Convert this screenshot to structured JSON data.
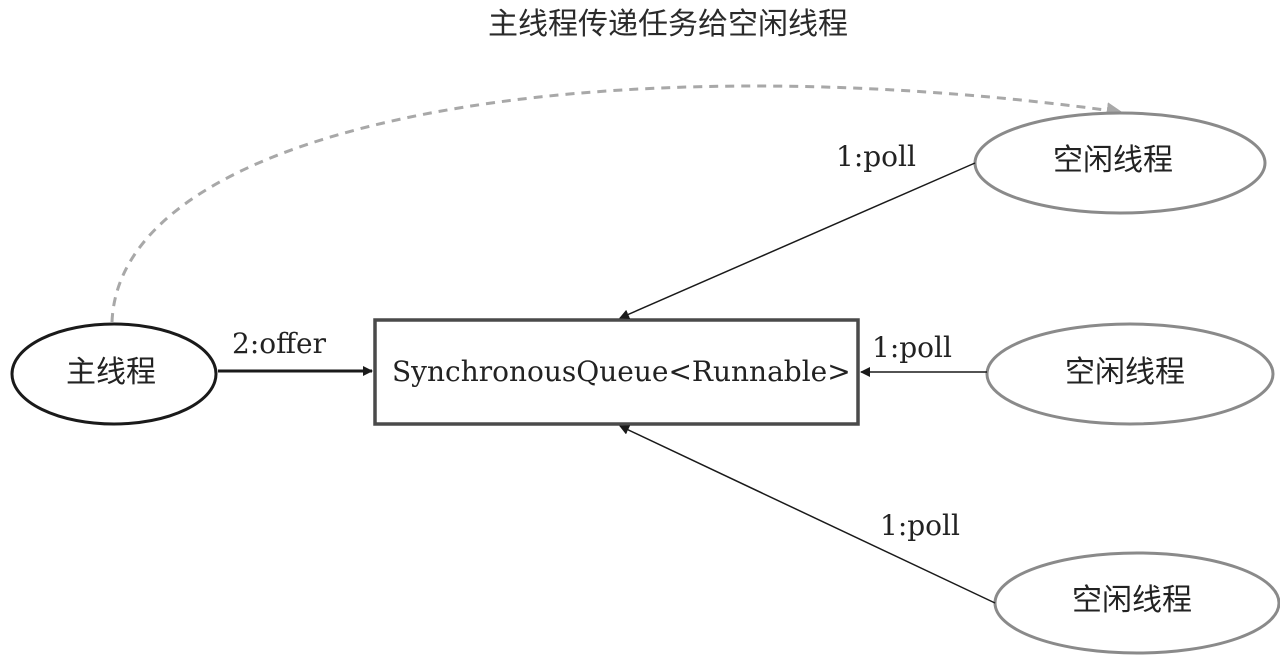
{
  "title": "主线程传递任务给空闲线程",
  "nodes": {
    "main_thread": "主线程",
    "queue": "SynchronousQueue<Runnable>",
    "idle_thread_top": "空闲线程",
    "idle_thread_middle": "空闲线程",
    "idle_thread_bottom": "空闲线程"
  },
  "edges": {
    "offer": "2:offer",
    "poll_top": "1:poll",
    "poll_middle": "1:poll",
    "poll_bottom": "1:poll"
  },
  "colors": {
    "main_border": "#1a1a1a",
    "idle_border": "#8a8a8a",
    "queue_border": "#4a4a4a",
    "dashed_arrow": "#a8a8a8",
    "edge": "#1a1a1a"
  }
}
